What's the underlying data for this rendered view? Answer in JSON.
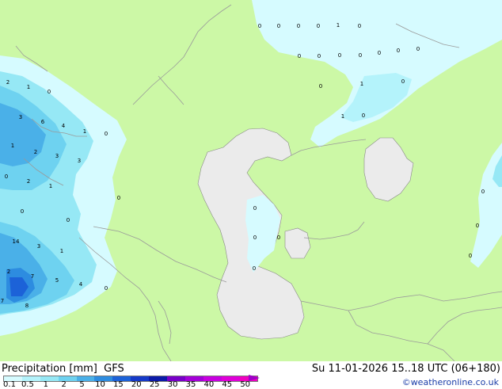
{
  "footer": {
    "title": "Precipitation [mm]  GFS",
    "valid_time": "Su 11-01-2026 15..18 UTC (06+180)",
    "credit": "©weatheronline.co.uk"
  },
  "legend": {
    "labels": [
      "0.1",
      "0.5",
      "1",
      "2",
      "5",
      "10",
      "15",
      "20",
      "25",
      "30",
      "35",
      "40",
      "45",
      "50"
    ],
    "colors": [
      "#d6fbff",
      "#b4f3fb",
      "#96e8f5",
      "#6ed2f0",
      "#4ab0e8",
      "#2d8ce0",
      "#1c62d8",
      "#1539c8",
      "#0b1aa8",
      "#7800c8",
      "#a400d8",
      "#c800e0",
      "#e000d8",
      "#f000c0"
    ]
  },
  "map_colors": {
    "land": "#ccf8a6",
    "water": "#ebebeb",
    "border": "#9a9a9a",
    "coast": "#888888",
    "precip_light": "#d6fbff",
    "precip_mid": "#96e8f5",
    "precip_heavy": "#4ab0e8",
    "precip_max": "#1c62d8"
  },
  "map_values": [
    {
      "name": "value-north-1",
      "text": "0"
    },
    {
      "name": "value-north-2",
      "text": "0"
    },
    {
      "name": "value-north-3",
      "text": "0"
    },
    {
      "name": "value-north-4",
      "text": "0"
    },
    {
      "name": "value-north-5",
      "text": "1"
    },
    {
      "name": "value-north-6",
      "text": "0"
    },
    {
      "name": "value-north-7",
      "text": "0"
    },
    {
      "name": "value-north-8",
      "text": "0"
    },
    {
      "name": "value-north-9",
      "text": "0"
    },
    {
      "name": "value-north-10",
      "text": "0"
    },
    {
      "name": "value-north-11",
      "text": "0"
    },
    {
      "name": "value-north-12",
      "text": "0"
    },
    {
      "name": "value-north-13",
      "text": "0"
    },
    {
      "name": "value-north-14",
      "text": "0"
    },
    {
      "name": "value-north-15",
      "text": "1"
    },
    {
      "name": "value-north-16",
      "text": "0"
    },
    {
      "name": "value-north-17",
      "text": "1"
    },
    {
      "name": "value-north-18",
      "text": "0"
    },
    {
      "name": "value-west-1",
      "text": "2"
    },
    {
      "name": "value-west-2",
      "text": "1"
    },
    {
      "name": "value-west-3",
      "text": "0"
    },
    {
      "name": "value-west-4",
      "text": "3"
    },
    {
      "name": "value-west-5",
      "text": "6"
    },
    {
      "name": "value-west-6",
      "text": "4"
    },
    {
      "name": "value-west-7",
      "text": "1"
    },
    {
      "name": "value-west-8",
      "text": "0"
    },
    {
      "name": "value-west-9",
      "text": "1"
    },
    {
      "name": "value-west-10",
      "text": "2"
    },
    {
      "name": "value-west-11",
      "text": "3"
    },
    {
      "name": "value-west-12",
      "text": "3"
    },
    {
      "name": "value-west-13",
      "text": "0"
    },
    {
      "name": "value-west-14",
      "text": "2"
    },
    {
      "name": "value-west-15",
      "text": "1"
    },
    {
      "name": "value-west-16",
      "text": "0"
    },
    {
      "name": "value-west-17",
      "text": "0"
    },
    {
      "name": "value-west-18",
      "text": "0"
    },
    {
      "name": "value-west-19",
      "text": "14"
    },
    {
      "name": "value-west-20",
      "text": "3"
    },
    {
      "name": "value-west-21",
      "text": "1"
    },
    {
      "name": "value-west-22",
      "text": "2"
    },
    {
      "name": "value-west-23",
      "text": "7"
    },
    {
      "name": "value-west-24",
      "text": "5"
    },
    {
      "name": "value-west-25",
      "text": "4"
    },
    {
      "name": "value-west-26",
      "text": "0"
    },
    {
      "name": "value-west-27",
      "text": "7"
    },
    {
      "name": "value-west-28",
      "text": "8"
    },
    {
      "name": "value-caspian-1",
      "text": "0"
    },
    {
      "name": "value-caspian-2",
      "text": "0"
    },
    {
      "name": "value-caspian-3",
      "text": "0"
    },
    {
      "name": "value-caspian-4",
      "text": "0"
    },
    {
      "name": "value-east-1",
      "text": "0"
    },
    {
      "name": "value-east-2",
      "text": "0"
    },
    {
      "name": "value-east-3",
      "text": "0"
    }
  ]
}
